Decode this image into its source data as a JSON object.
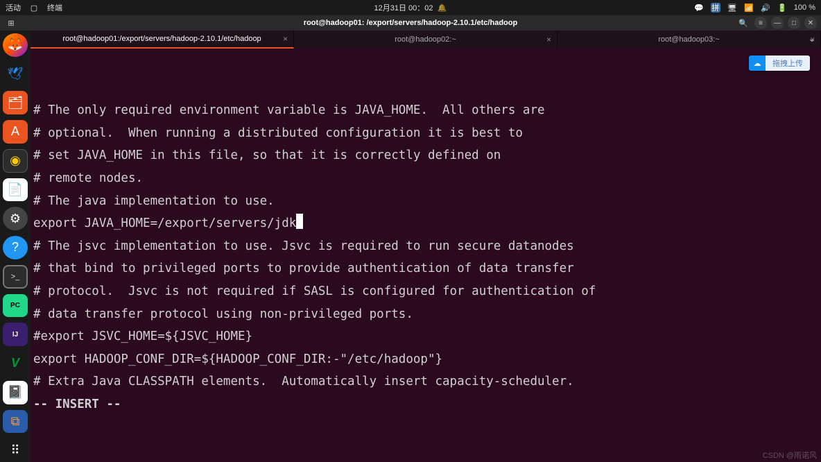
{
  "topbar": {
    "activities": "活动",
    "app_name": "终端",
    "datetime": "12月31日 00：02",
    "battery": "100 %"
  },
  "window": {
    "title": "root@hadoop01: /export/servers/hadoop-2.10.1/etc/hadoop"
  },
  "tabs": [
    {
      "label": "root@hadoop01:/export/servers/hadoop-2.10.1/etc/hadoop",
      "active": true
    },
    {
      "label": "root@hadoop02:~",
      "active": false
    },
    {
      "label": "root@hadoop03:~",
      "active": false
    }
  ],
  "editor_lines": [
    "# The only required environment variable is JAVA_HOME.  All others are",
    "# optional.  When running a distributed configuration it is best to",
    "# set JAVA_HOME in this file, so that it is correctly defined on",
    "# remote nodes.",
    "",
    "# The java implementation to use.",
    "export JAVA_HOME=/export/servers/jdk",
    "",
    "# The jsvc implementation to use. Jsvc is required to run secure datanodes",
    "# that bind to privileged ports to provide authentication of data transfer",
    "# protocol.  Jsvc is not required if SASL is configured for authentication of",
    "# data transfer protocol using non-privileged ports.",
    "#export JSVC_HOME=${JSVC_HOME}",
    "",
    "export HADOOP_CONF_DIR=${HADOOP_CONF_DIR:-\"/etc/hadoop\"}",
    "",
    "# Extra Java CLASSPATH elements.  Automatically insert capacity-scheduler."
  ],
  "vim_status": "-- INSERT --",
  "cursor_line_index": 6,
  "badge": {
    "text": "拖拽上传"
  },
  "watermark": "CSDN @雨诺风",
  "sidebar_apps": [
    {
      "name": "firefox",
      "glyph": "🦊"
    },
    {
      "name": "thunderbird",
      "glyph": "✉"
    },
    {
      "name": "files",
      "glyph": "📁"
    },
    {
      "name": "software",
      "glyph": "A"
    },
    {
      "name": "rhythmbox",
      "glyph": "◉"
    },
    {
      "name": "libreoffice-writer",
      "glyph": "📄"
    },
    {
      "name": "settings",
      "glyph": "⚙"
    },
    {
      "name": "help",
      "glyph": "?"
    },
    {
      "name": "terminal",
      "glyph": ">_"
    },
    {
      "name": "pycharm",
      "glyph": "PC"
    },
    {
      "name": "intellij",
      "glyph": "IJ"
    },
    {
      "name": "vim",
      "glyph": "V"
    },
    {
      "name": "notebook",
      "glyph": "📓"
    },
    {
      "name": "virtualbox",
      "glyph": "⧉"
    },
    {
      "name": "show-apps",
      "glyph": "⋮⋮⋮"
    }
  ]
}
